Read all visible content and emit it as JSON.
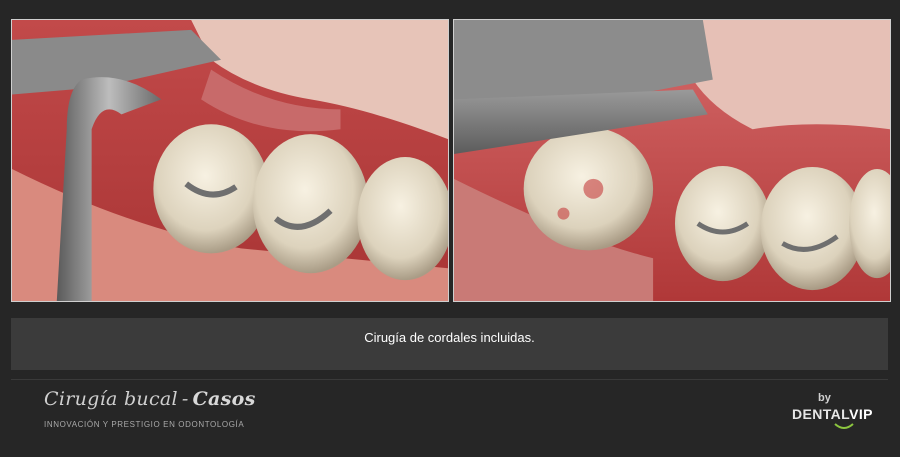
{
  "caption": "Cirugía de cordales incluidas.",
  "footer": {
    "title_main": "Cirugía bucal",
    "title_sep": "-",
    "title_bold": "Casos",
    "subtitle": "INNOVACIÓN Y PRESTIGIO EN ODONTOLOGÍA",
    "by_label": "by",
    "brand_dental": "DENTAL",
    "brand_vip": "VIP"
  },
  "colors": {
    "background": "#262626",
    "caption_bar": "#3b3b3b",
    "accent_green": "#8cc63f"
  }
}
